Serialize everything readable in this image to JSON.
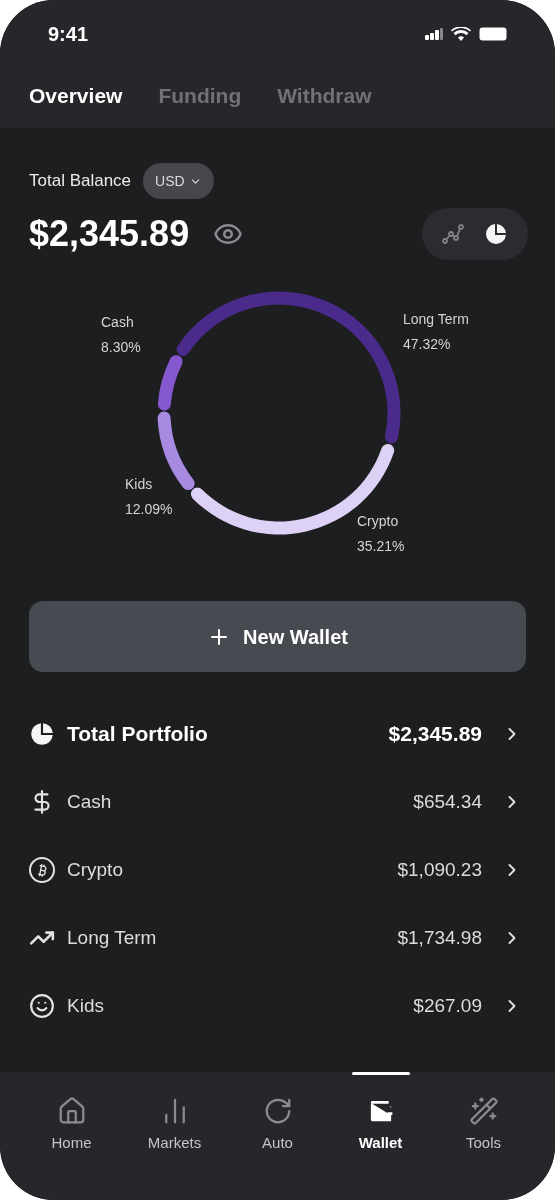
{
  "status_bar": {
    "time": "9:41"
  },
  "tabs": [
    {
      "label": "Overview",
      "selected": true
    },
    {
      "label": "Funding",
      "selected": false
    },
    {
      "label": "Withdraw",
      "selected": false
    }
  ],
  "balance": {
    "label": "Total Balance",
    "currency": "USD",
    "amount": "$2,345.89"
  },
  "view_toggle": [
    {
      "kind": "line",
      "selected": false
    },
    {
      "kind": "pie",
      "selected": true
    }
  ],
  "chart_data": {
    "type": "donut",
    "categories": [
      "Long Term",
      "Crypto",
      "Kids",
      "Cash"
    ],
    "values": [
      47.32,
      35.21,
      12.09,
      8.3
    ],
    "colors": [
      "#4a2a8a",
      "#ddd1f6",
      "#a98ae2",
      "#8558cf"
    ],
    "value_labels": [
      "47.32%",
      "35.21%",
      "12.09%",
      "8.30%"
    ]
  },
  "new_wallet_button": {
    "label": "New Wallet"
  },
  "wallets": [
    {
      "kind": "total",
      "name": "Total Portfolio",
      "amount": "$2,345.89"
    },
    {
      "kind": "cash",
      "name": "Cash",
      "amount": "$654.34"
    },
    {
      "kind": "crypto",
      "name": "Crypto",
      "amount": "$1,090.23"
    },
    {
      "kind": "longterm",
      "name": "Long Term",
      "amount": "$1,734.98"
    },
    {
      "kind": "kids",
      "name": "Kids",
      "amount": "$267.09"
    }
  ],
  "bottom_nav": [
    {
      "kind": "home",
      "label": "Home",
      "selected": false
    },
    {
      "kind": "markets",
      "label": "Markets",
      "selected": false
    },
    {
      "kind": "auto",
      "label": "Auto",
      "selected": false
    },
    {
      "kind": "wallet",
      "label": "Wallet",
      "selected": true
    },
    {
      "kind": "tools",
      "label": "Tools",
      "selected": false
    }
  ]
}
